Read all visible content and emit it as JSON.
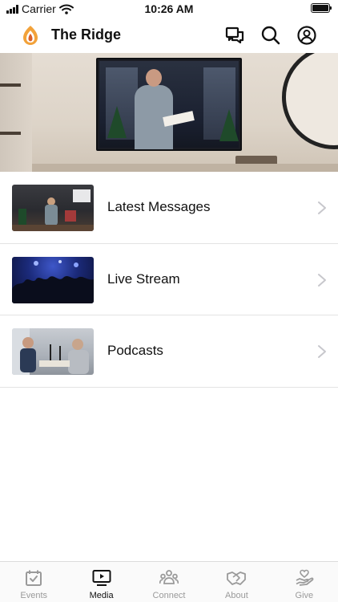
{
  "status_bar": {
    "carrier": "Carrier",
    "time": "10:26 AM"
  },
  "header": {
    "title": "The Ridge",
    "icons": [
      "logo-flame-icon",
      "chat-icon",
      "search-icon",
      "profile-icon"
    ]
  },
  "hero": {
    "image": "hero-photo-speaker-on-tv"
  },
  "media_items": [
    {
      "label": "Latest Messages",
      "thumbnail": "stage-speaker-photo"
    },
    {
      "label": "Live Stream",
      "thumbnail": "concert-crowd-photo"
    },
    {
      "label": "Podcasts",
      "thumbnail": "podcast-studio-photo"
    }
  ],
  "tab_bar": {
    "tabs": [
      {
        "label": "Events",
        "icon": "calendar-check-icon"
      },
      {
        "label": "Media",
        "icon": "play-screen-icon",
        "active": true
      },
      {
        "label": "Connect",
        "icon": "group-icon"
      },
      {
        "label": "About",
        "icon": "handshake-icon"
      },
      {
        "label": "Give",
        "icon": "give-heart-hand-icon"
      }
    ]
  },
  "colors": {
    "accent": "#e07a2a",
    "text": "#111111",
    "inactive": "#9a9a9a"
  }
}
